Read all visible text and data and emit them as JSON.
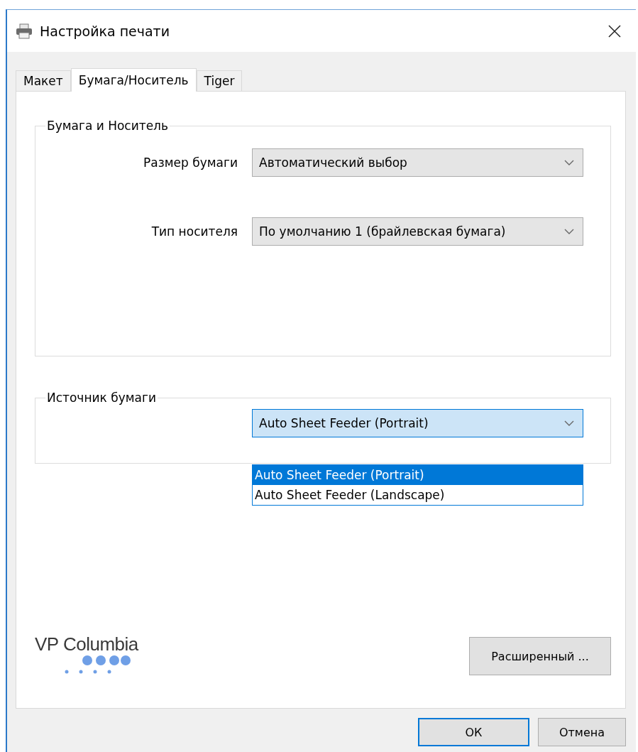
{
  "window": {
    "title": "Настройка печати"
  },
  "tabs": [
    {
      "label": "Макет",
      "selected": false
    },
    {
      "label": "Бумага/Носитель",
      "selected": true
    },
    {
      "label": "Tiger",
      "selected": false
    }
  ],
  "paper_group": {
    "title": "Бумага и Носитель",
    "fields": [
      {
        "label": "Размер бумаги",
        "value": "Автоматический выбор"
      },
      {
        "label": "Тип носителя",
        "value": "По умолчанию 1 (брайлевская бумага)"
      }
    ]
  },
  "source_group": {
    "title": "Источник бумаги",
    "value": "Auto Sheet Feeder (Portrait)",
    "expanded": true,
    "options": [
      {
        "label": "Auto Sheet Feeder (Portrait)",
        "selected": true
      },
      {
        "label": "Auto Sheet Feeder (Landscape)",
        "selected": false
      }
    ]
  },
  "logo": {
    "text": "VP Columbia"
  },
  "advanced_button": "Расширенный ...",
  "buttons": [
    {
      "label": "ОК",
      "default": true
    },
    {
      "label": "Отмена",
      "default": false
    }
  ]
}
